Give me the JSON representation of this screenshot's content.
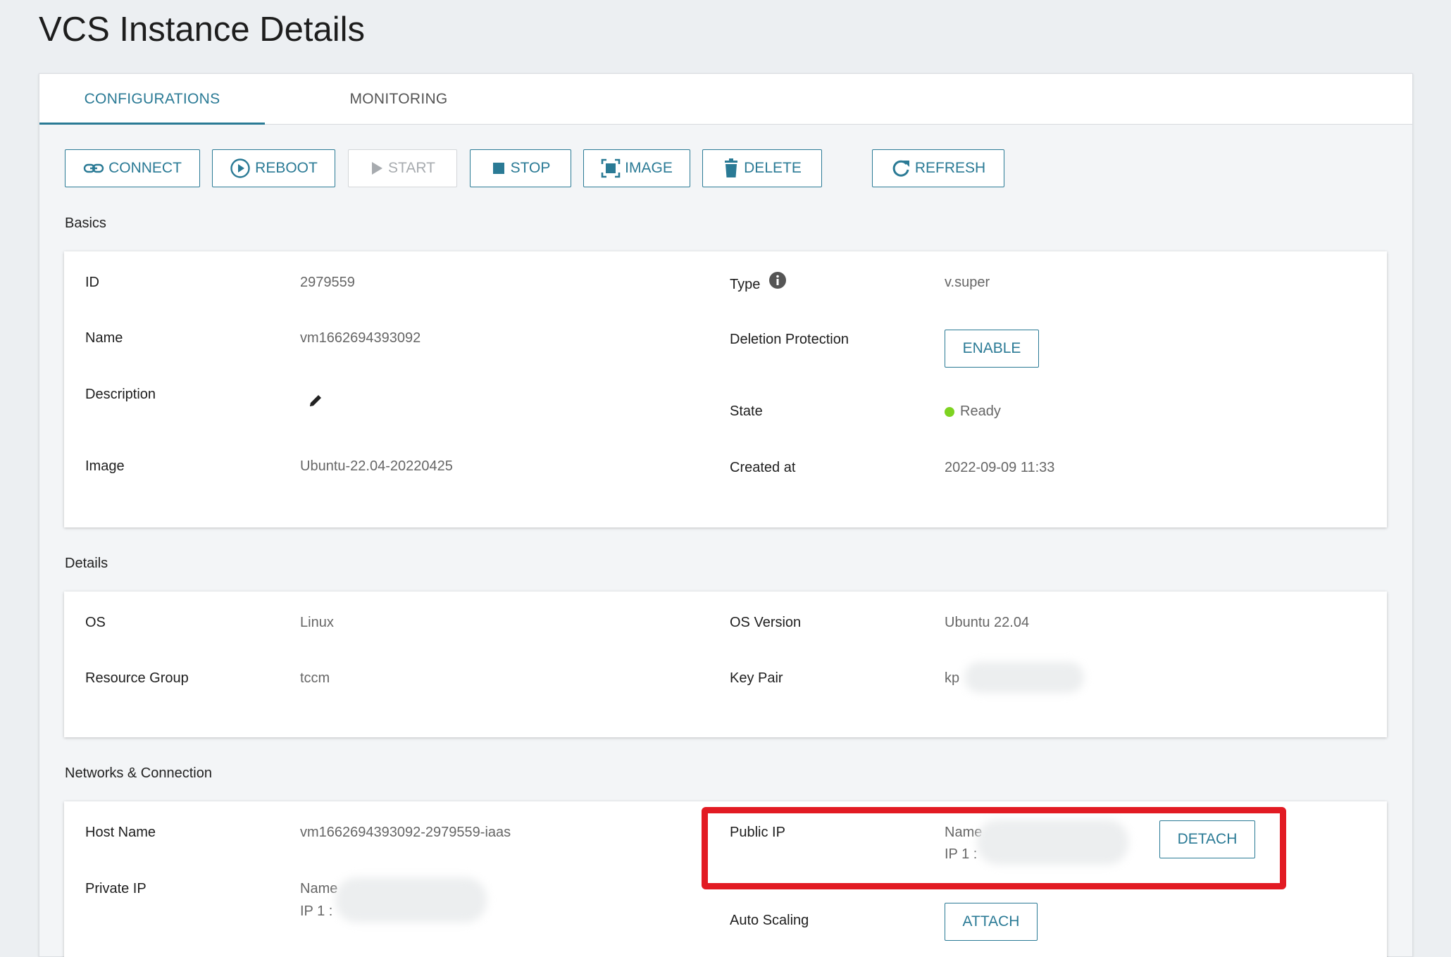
{
  "page": {
    "title": "VCS Instance Details"
  },
  "tabs": [
    {
      "label": "CONFIGURATIONS",
      "active": true
    },
    {
      "label": "MONITORING",
      "active": false
    }
  ],
  "toolbar": {
    "connect": "CONNECT",
    "reboot": "REBOOT",
    "start": "START",
    "stop": "STOP",
    "image": "IMAGE",
    "delete": "DELETE",
    "refresh": "REFRESH"
  },
  "basics": {
    "section": "Basics",
    "id_label": "ID",
    "id_value": "2979559",
    "name_label": "Name",
    "name_value": "vm1662694393092",
    "description_label": "Description",
    "image_label": "Image",
    "image_value": "Ubuntu-22.04-20220425",
    "type_label": "Type",
    "type_value": "v.super",
    "deletion_label": "Deletion Protection",
    "deletion_button": "ENABLE",
    "state_label": "State",
    "state_value": "Ready",
    "created_label": "Created at",
    "created_value": "2022-09-09 11:33"
  },
  "details": {
    "section": "Details",
    "os_label": "OS",
    "os_value": "Linux",
    "rg_label": "Resource Group",
    "rg_value": "tccm",
    "osver_label": "OS Version",
    "osver_value": "Ubuntu 22.04",
    "keypair_label": "Key Pair",
    "keypair_value": "kp"
  },
  "network": {
    "section": "Networks & Connection",
    "host_label": "Host Name",
    "host_value": "vm1662694393092-2979559-iaas",
    "private_label": "Private IP",
    "private_name": "Name",
    "private_ip": "IP 1 :",
    "public_label": "Public IP",
    "public_name": "Name",
    "public_ip": "IP 1 :",
    "detach_button": "DETACH",
    "autoscale_label": "Auto Scaling",
    "attach_button": "ATTACH"
  },
  "colors": {
    "accent": "#2a7a95",
    "ready_dot": "#7ed321",
    "highlight": "#e21b23"
  },
  "icons": {
    "connect": "link-icon",
    "reboot": "play-circle-icon",
    "start": "play-icon",
    "stop": "stop-square-icon",
    "image": "image-frame-icon",
    "delete": "trash-icon",
    "refresh": "refresh-icon",
    "info": "info-icon",
    "edit": "pencil-icon",
    "status": "status-dot-icon"
  }
}
